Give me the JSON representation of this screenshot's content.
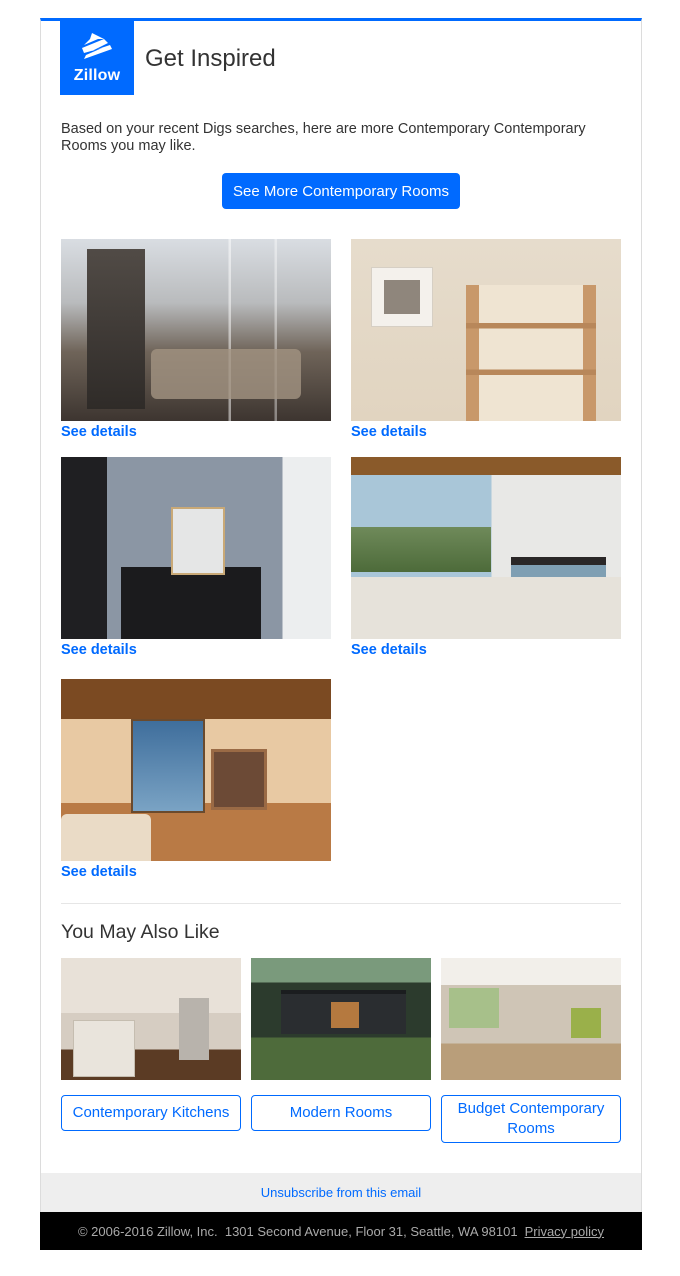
{
  "brand": {
    "logo_text": "Zillow",
    "accent_color": "#006aff"
  },
  "header": {
    "title": "Get Inspired"
  },
  "intro": {
    "text": "Based on your recent Digs searches, here are more Contemporary Contemporary Rooms you may like.",
    "cta_label": "See More Contemporary Rooms"
  },
  "gallery": {
    "items": [
      {
        "image": "contemporary living room with tall windows",
        "link_label": "See details"
      },
      {
        "image": "wooden staggered bookshelf with decor",
        "link_label": "See details"
      },
      {
        "image": "dark desk with chairs and chess knight sculpture",
        "link_label": "See details"
      },
      {
        "image": "bright bedroom with wood-beam ceiling and view",
        "link_label": "See details"
      },
      {
        "image": "living room with wood beams and fireplace",
        "link_label": "See details"
      }
    ]
  },
  "also_like": {
    "title": "You May Also Like",
    "items": [
      {
        "image": "white kitchen with arch",
        "label": "Contemporary Kitchens"
      },
      {
        "image": "dark modern cabin with deck",
        "label": "Modern Rooms"
      },
      {
        "image": "bright living room with fireplace",
        "label": "Budget Contemporary Rooms"
      }
    ]
  },
  "footer": {
    "unsubscribe_label": "Unsubscribe from this email",
    "copyright": "© 2006-2016 Zillow, Inc.  1301 Second Avenue, Floor 31, Seattle, WA 98101",
    "privacy_label": "Privacy policy"
  }
}
